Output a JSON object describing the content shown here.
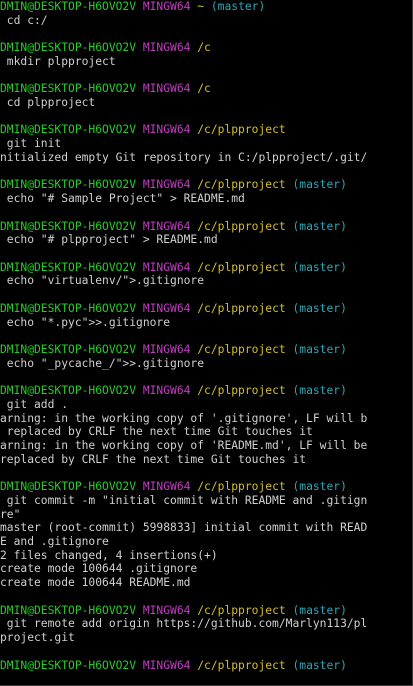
{
  "terminal": {
    "colors": {
      "background": "#000000",
      "text": "#d0d0d0",
      "user": "#1fd21f",
      "host": "#c33cc3",
      "path": "#d4c01e",
      "branch": "#2aa8b8"
    },
    "lines": [
      [
        {
          "t": "DMIN@DESKTOP-H6OVO2V",
          "c": "user"
        },
        {
          "t": " MINGW64",
          "c": "host"
        },
        {
          "t": " ~",
          "c": "path"
        },
        {
          "t": " (master)",
          "c": "branch"
        }
      ],
      [
        {
          "t": " cd c:/",
          "c": "text"
        }
      ],
      [],
      [
        {
          "t": "DMIN@DESKTOP-H6OVO2V",
          "c": "user"
        },
        {
          "t": " MINGW64",
          "c": "host"
        },
        {
          "t": " /c",
          "c": "path"
        }
      ],
      [
        {
          "t": " mkdir plpproject",
          "c": "text"
        }
      ],
      [],
      [
        {
          "t": "DMIN@DESKTOP-H6OVO2V",
          "c": "user"
        },
        {
          "t": " MINGW64",
          "c": "host"
        },
        {
          "t": " /c",
          "c": "path"
        }
      ],
      [
        {
          "t": " cd plpproject",
          "c": "text"
        }
      ],
      [],
      [
        {
          "t": "DMIN@DESKTOP-H6OVO2V",
          "c": "user"
        },
        {
          "t": " MINGW64",
          "c": "host"
        },
        {
          "t": " /c/plpproject",
          "c": "path"
        }
      ],
      [
        {
          "t": " git init",
          "c": "text"
        }
      ],
      [
        {
          "t": "nitialized empty Git repository in C:/plpproject/.git/",
          "c": "text"
        }
      ],
      [],
      [
        {
          "t": "DMIN@DESKTOP-H6OVO2V",
          "c": "user"
        },
        {
          "t": " MINGW64",
          "c": "host"
        },
        {
          "t": " /c/plpproject",
          "c": "path"
        },
        {
          "t": " (master)",
          "c": "branch"
        }
      ],
      [
        {
          "t": " echo \"# Sample Project\" > README.md",
          "c": "text"
        }
      ],
      [],
      [
        {
          "t": "DMIN@DESKTOP-H6OVO2V",
          "c": "user"
        },
        {
          "t": " MINGW64",
          "c": "host"
        },
        {
          "t": " /c/plpproject",
          "c": "path"
        },
        {
          "t": " (master)",
          "c": "branch"
        }
      ],
      [
        {
          "t": " echo \"# plpproject\" > README.md",
          "c": "text"
        }
      ],
      [],
      [
        {
          "t": "DMIN@DESKTOP-H6OVO2V",
          "c": "user"
        },
        {
          "t": " MINGW64",
          "c": "host"
        },
        {
          "t": " /c/plpproject",
          "c": "path"
        },
        {
          "t": " (master)",
          "c": "branch"
        }
      ],
      [
        {
          "t": " echo \"virtualenv/\">.gitignore",
          "c": "text"
        }
      ],
      [],
      [
        {
          "t": "DMIN@DESKTOP-H6OVO2V",
          "c": "user"
        },
        {
          "t": " MINGW64",
          "c": "host"
        },
        {
          "t": " /c/plpproject",
          "c": "path"
        },
        {
          "t": " (master)",
          "c": "branch"
        }
      ],
      [
        {
          "t": " echo \"*.pyc\">>.gitignore",
          "c": "text"
        }
      ],
      [],
      [
        {
          "t": "DMIN@DESKTOP-H6OVO2V",
          "c": "user"
        },
        {
          "t": " MINGW64",
          "c": "host"
        },
        {
          "t": " /c/plpproject",
          "c": "path"
        },
        {
          "t": " (master)",
          "c": "branch"
        }
      ],
      [
        {
          "t": " echo \"_pycache_/\">>.gitignore",
          "c": "text"
        }
      ],
      [],
      [
        {
          "t": "DMIN@DESKTOP-H6OVO2V",
          "c": "user"
        },
        {
          "t": " MINGW64",
          "c": "host"
        },
        {
          "t": " /c/plpproject",
          "c": "path"
        },
        {
          "t": " (master)",
          "c": "branch"
        }
      ],
      [
        {
          "t": " git add .",
          "c": "text"
        }
      ],
      [
        {
          "t": "arning: in the working copy of '.gitignore', LF will b",
          "c": "text"
        }
      ],
      [
        {
          "t": " replaced by CRLF the next time Git touches it",
          "c": "text"
        }
      ],
      [
        {
          "t": "arning: in the working copy of 'README.md', LF will be",
          "c": "text"
        }
      ],
      [
        {
          "t": "replaced by CRLF the next time Git touches it",
          "c": "text"
        }
      ],
      [],
      [
        {
          "t": "DMIN@DESKTOP-H6OVO2V",
          "c": "user"
        },
        {
          "t": " MINGW64",
          "c": "host"
        },
        {
          "t": " /c/plpproject",
          "c": "path"
        },
        {
          "t": " (master)",
          "c": "branch"
        }
      ],
      [
        {
          "t": " git commit -m \"initial commit with README and .gitign",
          "c": "text"
        }
      ],
      [
        {
          "t": "re\"",
          "c": "text"
        }
      ],
      [
        {
          "t": "master (root-commit) 5998833] initial commit with READ",
          "c": "text"
        }
      ],
      [
        {
          "t": "E and .gitignore",
          "c": "text"
        }
      ],
      [
        {
          "t": "2 files changed, 4 insertions(+)",
          "c": "text"
        }
      ],
      [
        {
          "t": "create mode 100644 .gitignore",
          "c": "text"
        }
      ],
      [
        {
          "t": "create mode 100644 README.md",
          "c": "text"
        }
      ],
      [],
      [
        {
          "t": "DMIN@DESKTOP-H6OVO2V",
          "c": "user"
        },
        {
          "t": " MINGW64",
          "c": "host"
        },
        {
          "t": " /c/plpproject",
          "c": "path"
        },
        {
          "t": " (master)",
          "c": "branch"
        }
      ],
      [
        {
          "t": " git remote add origin https://github.com/Marlyn113/pl",
          "c": "text"
        }
      ],
      [
        {
          "t": "project.git",
          "c": "text"
        }
      ],
      [],
      [
        {
          "t": "DMIN@DESKTOP-H6OVO2V",
          "c": "user"
        },
        {
          "t": " MINGW64",
          "c": "host"
        },
        {
          "t": " /c/plpproject",
          "c": "path"
        },
        {
          "t": " (master)",
          "c": "branch"
        }
      ]
    ]
  }
}
